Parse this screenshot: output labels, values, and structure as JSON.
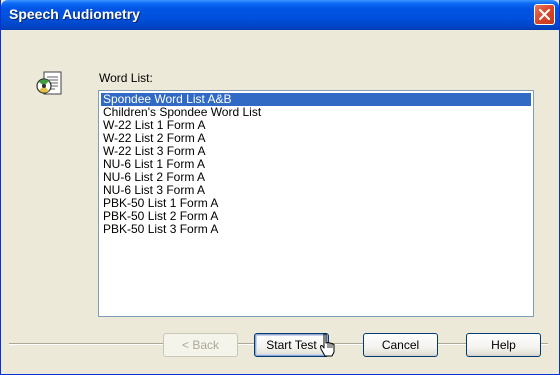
{
  "window": {
    "title": "Speech Audiometry"
  },
  "icons": {
    "close": "close-icon",
    "app": "speech-audiometry-icon",
    "cursor": "mouse-pointer-icon"
  },
  "form": {
    "word_list_label": "Word List:",
    "items": [
      "Spondee Word List A&B",
      "Children's Spondee Word List",
      "W-22 List 1 Form A",
      "W-22 List 2 Form A",
      "W-22 List 3 Form A",
      "NU-6 List 1 Form A",
      "NU-6 List 2 Form A",
      "NU-6 List 3 Form A",
      "PBK-50 List 1 Form A",
      "PBK-50 List 2 Form A",
      "PBK-50 List 3 Form A"
    ],
    "selected_index": 0
  },
  "buttons": {
    "back": "< Back",
    "start_test": "Start Test",
    "cancel": "Cancel",
    "help": "Help"
  },
  "colors": {
    "titlebar": "#0054e3",
    "selection": "#316ac5",
    "close_button": "#d8472a"
  }
}
